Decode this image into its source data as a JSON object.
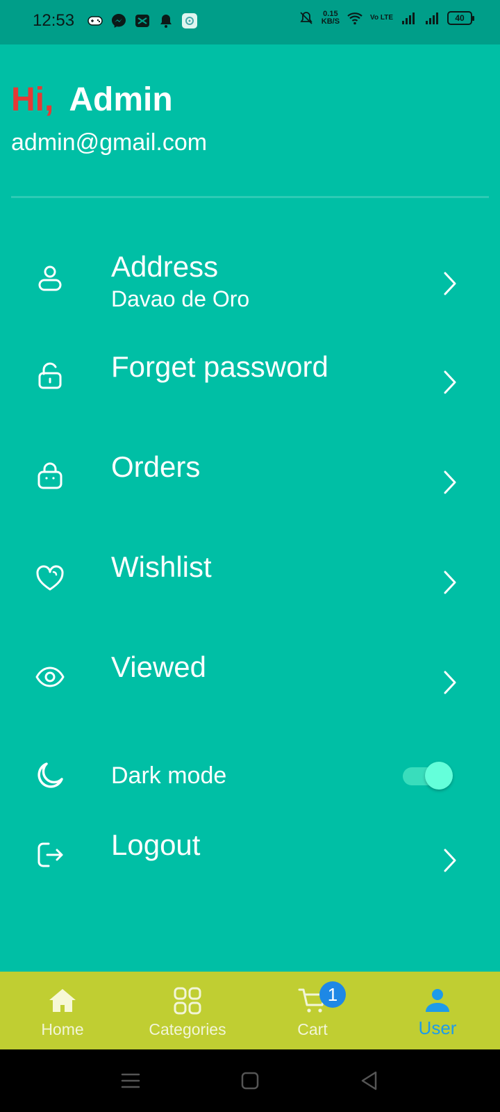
{
  "status_bar": {
    "time": "12:53",
    "net_speed_value": "0.15",
    "net_speed_unit": "KB/S",
    "volte": "Vo LTE",
    "battery": "40",
    "left_icons": [
      "game-controller-icon",
      "messenger-icon",
      "capcut-icon",
      "bell-icon",
      "app-icon"
    ],
    "right_icons": [
      "bell-off-icon",
      "wifi-icon",
      "signal-icon",
      "signal-icon"
    ]
  },
  "header": {
    "hi": "Hi,",
    "name": "Admin",
    "email": "admin@gmail.com"
  },
  "menu": {
    "address": {
      "title": "Address",
      "subtitle": "Davao de Oro",
      "icon": "user-icon"
    },
    "forget_password": {
      "title": "Forget password",
      "icon": "lock-icon"
    },
    "orders": {
      "title": "Orders",
      "icon": "bag-icon"
    },
    "wishlist": {
      "title": "Wishlist",
      "icon": "heart-icon"
    },
    "viewed": {
      "title": "Viewed",
      "icon": "eye-icon"
    },
    "dark_mode": {
      "title": "Dark mode",
      "icon": "moon-icon",
      "enabled": true
    },
    "logout": {
      "title": "Logout",
      "icon": "logout-icon"
    }
  },
  "bottom_nav": {
    "items": [
      {
        "label": "Home",
        "icon": "home-icon",
        "active": false
      },
      {
        "label": "Categories",
        "icon": "categories-icon",
        "active": false
      },
      {
        "label": "Cart",
        "icon": "cart-icon",
        "active": false,
        "badge": "1"
      },
      {
        "label": "User",
        "icon": "user-icon",
        "active": true
      }
    ]
  },
  "colors": {
    "background": "#00bfa5",
    "status_bar": "#009e89",
    "hi_red": "#e53935",
    "bottom_nav": "#c0ce32",
    "active_blue": "#1e9be9",
    "badge_blue": "#1e88e5",
    "toggle": "#64ffda"
  }
}
